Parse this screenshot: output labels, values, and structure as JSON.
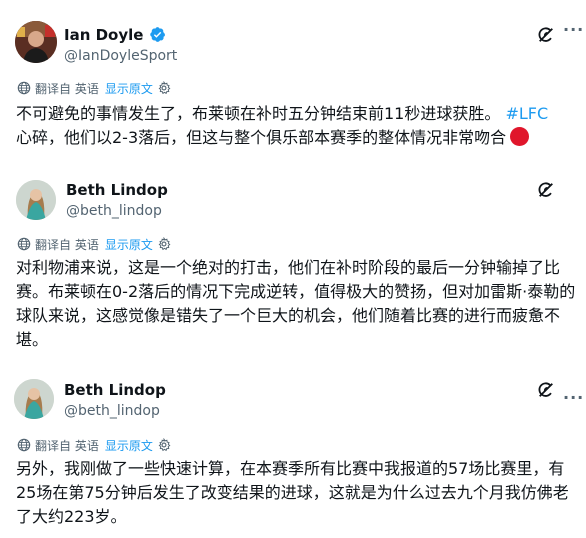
{
  "tweets": [
    {
      "author": "Ian Doyle",
      "handle": "@IanDoyleSport",
      "verified": true,
      "translated_from": "翻译自 英语",
      "show_original": "显示原文",
      "text_main": "不可避免的事情发生了，布莱顿在补时五分钟结束前11秒进球获胜。",
      "hashtag": "#LFC",
      "text_line2": "心碎，他们以2-3落后，但这与整个俱乐部本赛季的整体情况非常吻合",
      "emoji": "red-circle",
      "icons": [
        "avatar",
        "verified-badge-icon",
        "grok-icon",
        "more-icon",
        "globe-icon",
        "settings-icon"
      ]
    },
    {
      "author": "Beth Lindop",
      "handle": "@beth_lindop",
      "translated_from": "翻译自 英语",
      "show_original": "显示原文",
      "text": "对利物浦来说，这是一个绝对的打击，他们在补时阶段的最后一分钟输掉了比赛。布莱顿在0-2落后的情况下完成逆转，值得极大的赞扬，但对加雷斯·泰勒的球队来说，这感觉像是错失了一个巨大的机会，他们随着比赛的进行而疲惫不堪。"
    },
    {
      "author": "Beth Lindop",
      "handle": "@beth_lindop",
      "translated_from": "翻译自 英语",
      "show_original": "显示原文",
      "text": "另外，我刚做了一些快速计算，在本赛季所有比赛中我报道的57场比赛里，有25场在第75分钟后发生了改变结果的进球，这就是为什么过去九个月我仿佛老了大约223岁。"
    }
  ],
  "colors": {
    "accent": "#1d9bf0",
    "secondary": "#536471",
    "text": "#0f1419",
    "emoji_red": "#e0162b"
  }
}
